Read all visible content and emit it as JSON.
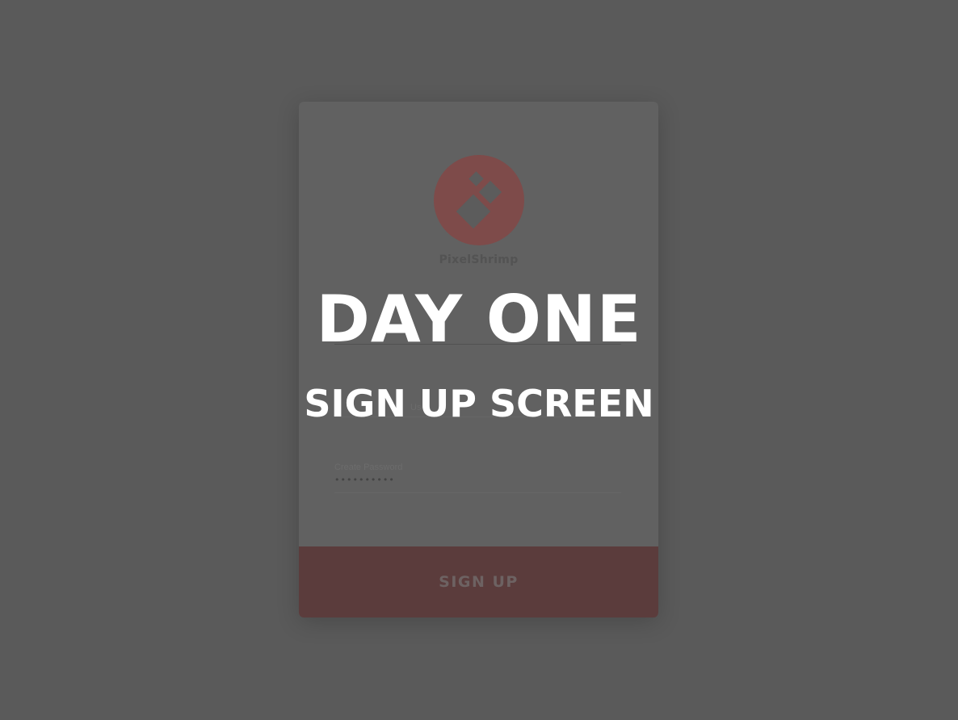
{
  "overlay": {
    "title": "DAY ONE",
    "subtitle": "SIGN UP SCREEN"
  },
  "card": {
    "brand_name": "PixelShrimp",
    "logo_icon": "diamond-shrimp-logo-icon",
    "email_field": {
      "label": "",
      "value": "y"
    },
    "username_field": {
      "label": "Use"
    },
    "password_field": {
      "label": "Create Password",
      "value": "••••••••••"
    },
    "signup_label": "SIGN UP"
  },
  "colors": {
    "background": "#5a5a5a",
    "card": "#616161",
    "accent": "#7e4b4a",
    "button": "#5b3c3c",
    "overlay_text": "#ffffff"
  }
}
